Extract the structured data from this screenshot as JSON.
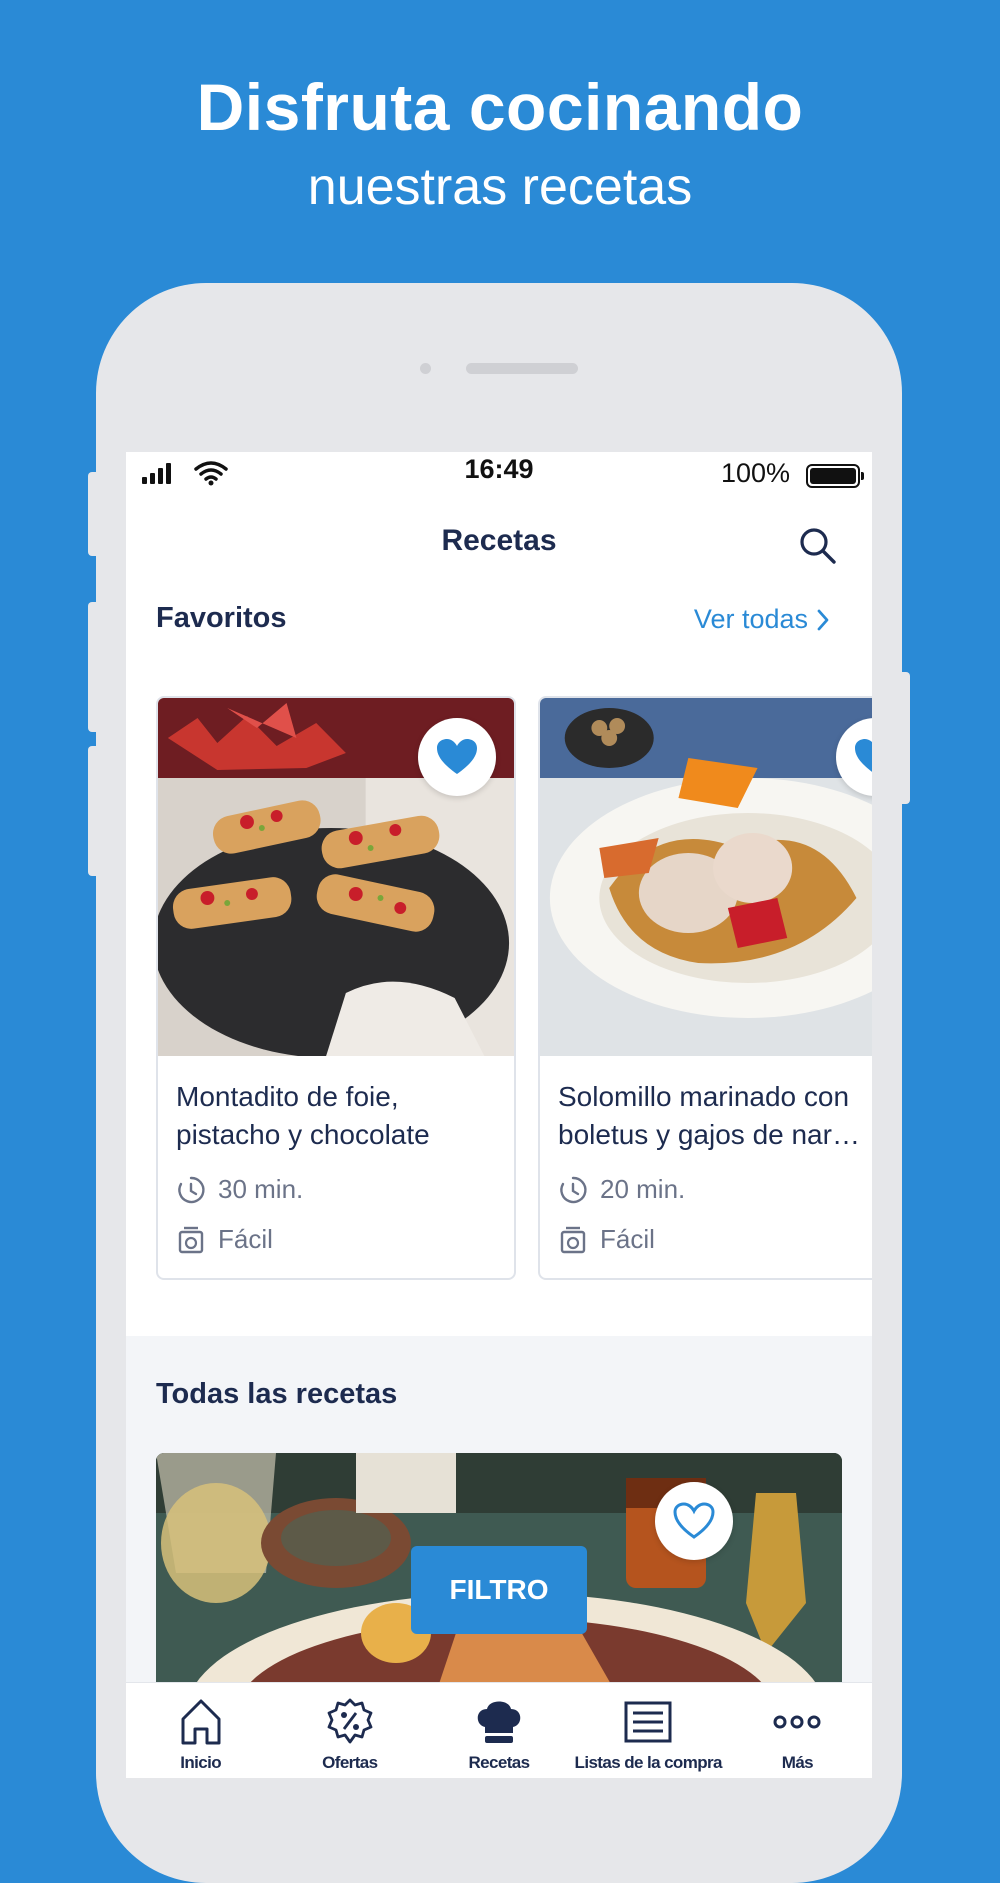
{
  "promo": {
    "line1": "Disfruta cocinando",
    "line2": "nuestras recetas"
  },
  "status": {
    "time": "16:49",
    "battery": "100%"
  },
  "header": {
    "title": "Recetas"
  },
  "favorites": {
    "title": "Favoritos",
    "see_all": "Ver todas",
    "cards": [
      {
        "name": "Montadito de foie,\npistacho y chocolate",
        "time": "30 min.",
        "difficulty": "Fácil",
        "favorited": true
      },
      {
        "name": "Solomillo marinado con\nboletus y gajos de nar…",
        "time": "20 min.",
        "difficulty": "Fácil",
        "favorited": true
      }
    ]
  },
  "all_recipes": {
    "title": "Todas las recetas",
    "filter_label": "FILTRO"
  },
  "tabbar": {
    "items": [
      {
        "label": "Inicio",
        "icon": "home-icon"
      },
      {
        "label": "Ofertas",
        "icon": "discount-badge-icon"
      },
      {
        "label": "Recetas",
        "icon": "chef-hat-icon"
      },
      {
        "label": "Listas de la compra",
        "icon": "list-icon"
      },
      {
        "label": "Más",
        "icon": "more-dots-icon"
      }
    ]
  },
  "colors": {
    "brand_blue": "#2a8ad6",
    "navy_text": "#1d2b4f"
  }
}
